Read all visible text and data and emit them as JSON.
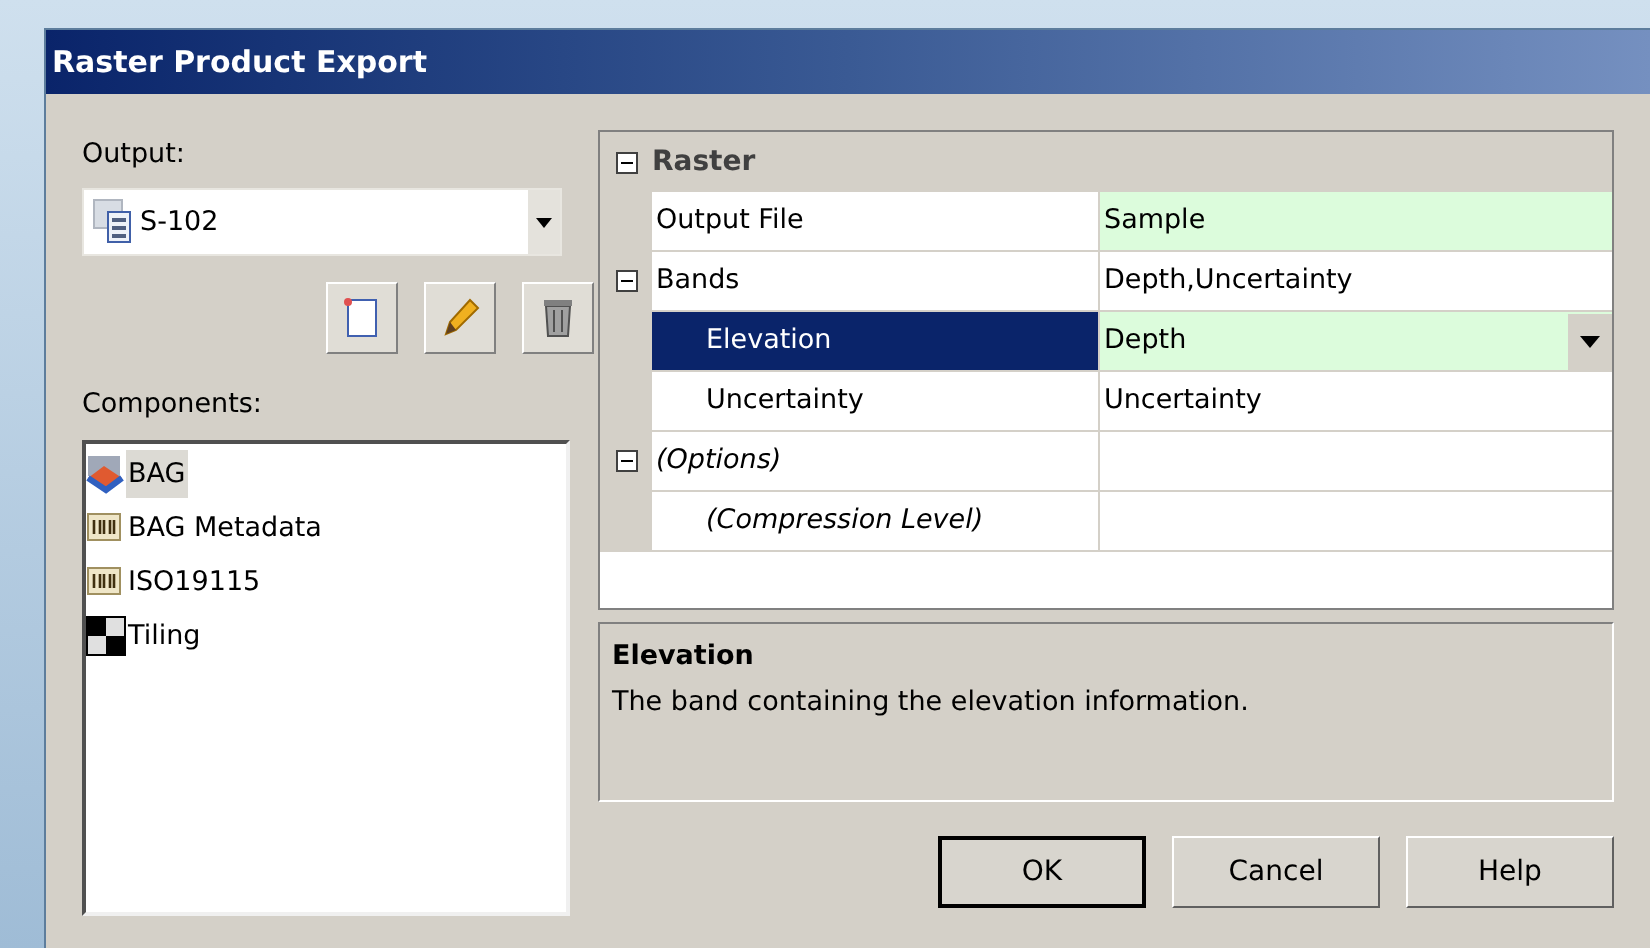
{
  "window": {
    "title": "Raster Product Export"
  },
  "output": {
    "label": "Output:",
    "value": "S-102"
  },
  "toolbar": [
    {
      "kind": "new"
    },
    {
      "kind": "edit"
    },
    {
      "kind": "delete"
    }
  ],
  "components": {
    "label": "Components:",
    "items": [
      {
        "label": "BAG",
        "kind": "raster",
        "selected": true
      },
      {
        "label": "BAG Metadata",
        "kind": "metadata",
        "selected": false
      },
      {
        "label": "ISO19115",
        "kind": "metadata",
        "selected": false
      },
      {
        "label": "Tiling",
        "kind": "tiling",
        "selected": false
      }
    ]
  },
  "property_grid": {
    "categories": [
      {
        "label": "Raster",
        "expanded": true,
        "properties": [
          {
            "name": "Output File",
            "value": "Sample",
            "modified": true,
            "selected": false,
            "italic": false
          },
          {
            "name": "Bands",
            "value": "Depth,Uncertainty",
            "modified": false,
            "selected": false,
            "italic": false,
            "expanded": true,
            "children": [
              {
                "name": "Elevation",
                "value": "Depth",
                "modified": true,
                "selected": true,
                "italic": false
              },
              {
                "name": "Uncertainty",
                "value": "Uncertainty",
                "modified": false,
                "selected": false,
                "italic": false
              }
            ]
          },
          {
            "name": "(Options)",
            "modified": false,
            "selected": false,
            "italic": true,
            "expanded": true,
            "children": [
              {
                "name": "(Compression Level)",
                "modified": false,
                "selected": false,
                "italic": true
              }
            ]
          }
        ]
      }
    ]
  },
  "description": {
    "title": "Elevation",
    "text": "The band containing the elevation information."
  },
  "buttons": [
    {
      "label": "OK",
      "default": true
    },
    {
      "label": "Cancel",
      "default": false
    },
    {
      "label": "Help",
      "default": false
    }
  ]
}
